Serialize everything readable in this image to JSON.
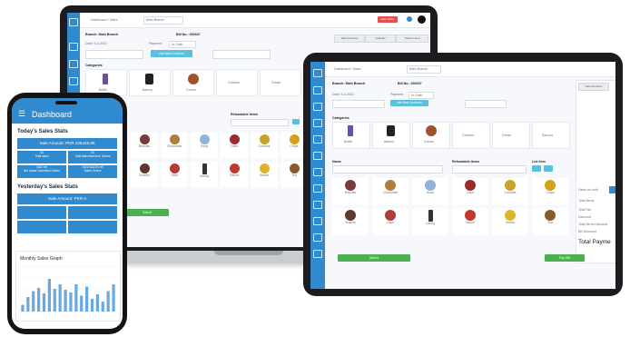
{
  "phone": {
    "header_title": "Dashboard",
    "today_title": "Today's Sales Stats",
    "today_amount": "Sale Amount: PKR 226426.95",
    "today_cells": [
      {
        "value": "34",
        "label": "Total sales"
      },
      {
        "value": "34",
        "label": "Total Manufacturers' Orders"
      },
      {
        "value": "4422 ref",
        "label": "Net Lease Cancelled Orders"
      },
      {
        "value": "4422 SALES ref",
        "label": "Sales Orders"
      }
    ],
    "yesterday_title": "Yesterday's Sales Stats",
    "yesterday_amount": "Sale Amount: PKR 0",
    "graph_title": "Monthly Sales Graph",
    "graph_values": [
      0.15,
      0.32,
      0.45,
      0.52,
      0.4,
      0.72,
      0.5,
      0.6,
      0.48,
      0.42,
      0.6,
      0.35,
      0.55,
      0.28,
      0.38,
      0.22,
      0.45,
      0.6
    ]
  },
  "laptop": {
    "breadcrumb": "Dashboard / Sales",
    "branch_select": "Main Branch",
    "red_button": "Main Order",
    "branch_label": "Branch: Main Branch",
    "bill_label": "Bill No.: 000347",
    "date_label": "Date: 6-4-2021",
    "payment_label": "Payment",
    "payment_value": "In Cash",
    "add_customer": "Add New Customer",
    "tabs": [
      "Sale Products",
      "Quantity",
      "Total Amount"
    ],
    "categories_label": "Categories",
    "refundable_label": "Refundable Items",
    "green_button": "Select",
    "category_names": [
      "Bottle",
      "Bakery",
      "Cream",
      "Chicken",
      "Drinks",
      "Sauces"
    ],
    "product_names": [
      "Biscuits",
      "Chocolate",
      "Soup",
      "Cake",
      "Cookies",
      "Chips",
      "Snacks",
      "Juice",
      "Candy",
      "Sauce",
      "Bread",
      "Tea"
    ]
  },
  "tablet": {
    "breadcrumb": "Dashboard / Sales",
    "branch_select": "Main Branch",
    "branch_label": "Branch: Main Branch",
    "bill_label": "Bill No.: 000347",
    "date_label": "Date: 6-4-2021",
    "payment_label": "Payment",
    "payment_value": "In Cash",
    "add_customer": "Add New Customer",
    "tab": "Sale Products",
    "categories_label": "Categories",
    "name_label": "Name",
    "refundable_label": "Refundable Items",
    "list_item_label": "List Item",
    "select_button": "Select",
    "pay_button": "Pay Bill",
    "category_names": [
      "Bottle",
      "Bakery",
      "Cream",
      "Chicken",
      "Drinks",
      "Sauces"
    ],
    "product_names": [
      "Biscuits",
      "Chocolate",
      "Soup",
      "Cake",
      "Cookies",
      "Chips",
      "Snacks",
      "Juice",
      "Candy",
      "Sauce",
      "Bread",
      "Tea"
    ],
    "summary_lines": [
      "Sales on hold",
      "Total Items",
      "Total Tax",
      "Discount",
      "Total Items Discount",
      "Bill Discount"
    ],
    "total_payment": "Total Payme"
  },
  "colors": {
    "primary": "#2f8ad0",
    "teal": "#5bc0de",
    "green": "#4caf50",
    "red": "#e05252"
  }
}
